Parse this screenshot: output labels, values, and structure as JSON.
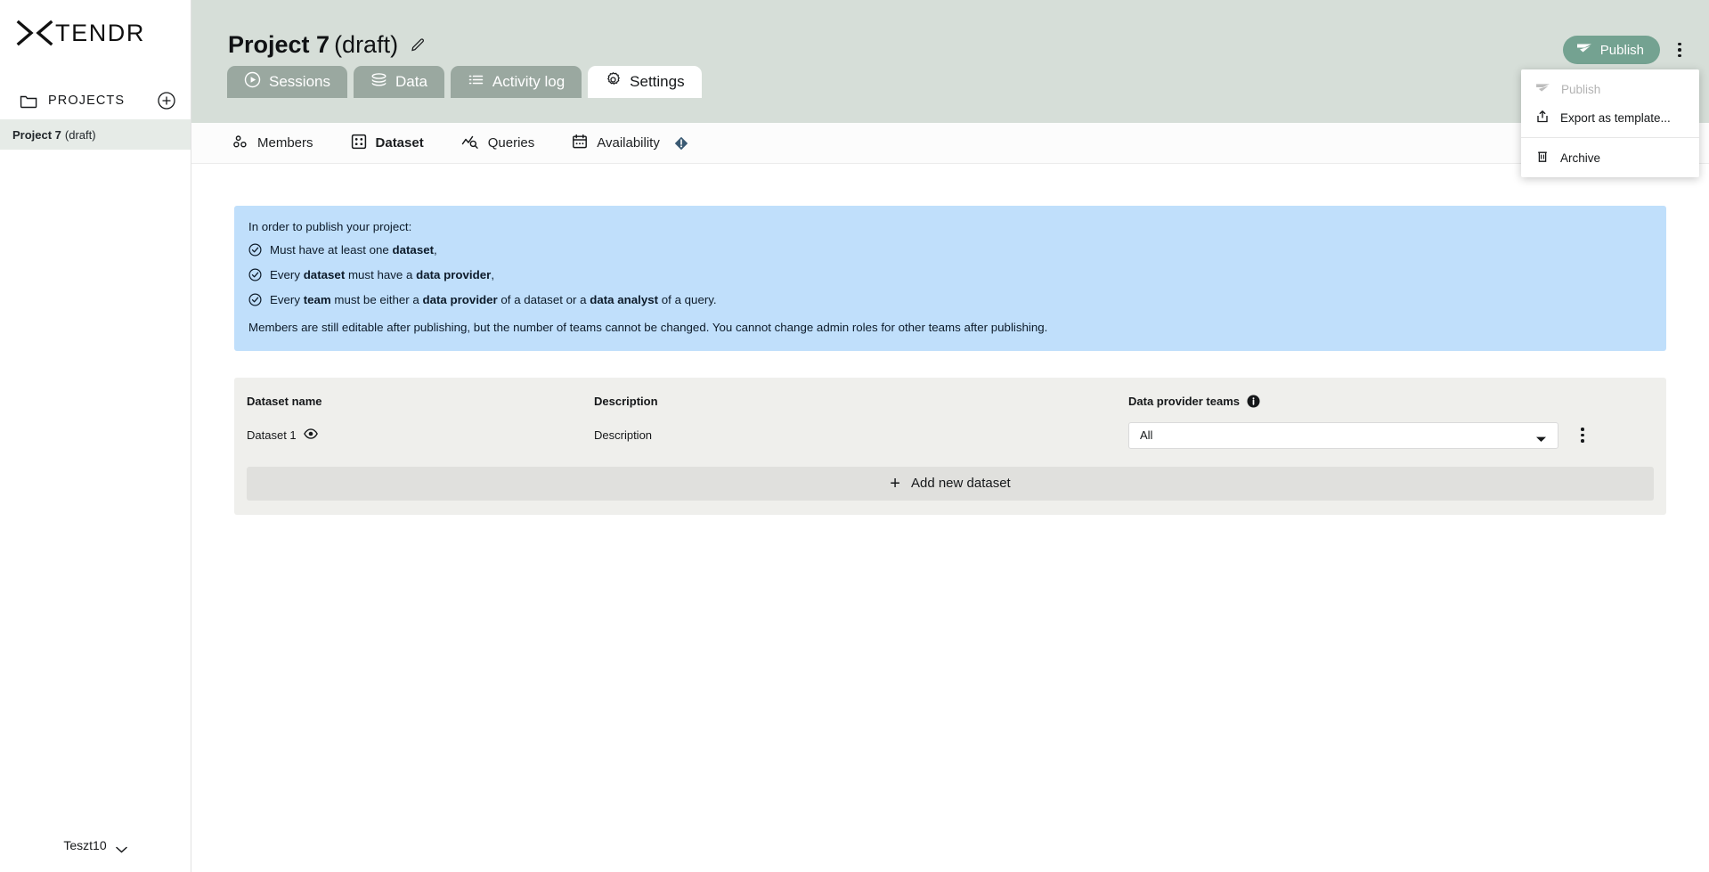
{
  "brand": {
    "name": "TENDR",
    "logo_mark": "x-arrows-icon"
  },
  "sidebar": {
    "projects_header": "PROJECTS",
    "add_project_icon": "plus-circle-icon",
    "folder_icon": "folder-icon",
    "projects": [
      {
        "name": "Project 7",
        "state": "(draft)",
        "selected": true
      }
    ],
    "user": {
      "name": "Teszt10",
      "chevron_icon": "chevron-down-icon"
    }
  },
  "header": {
    "project_name": "Project 7",
    "project_state": "(draft)",
    "edit_icon": "pencil-icon",
    "publish_button": {
      "label": "Publish",
      "icon": "send-icon",
      "color": "#74a291"
    },
    "kebab_icon": "kebab-menu-icon"
  },
  "menu": {
    "items": [
      {
        "label": "Publish",
        "icon": "send-icon",
        "disabled": true
      },
      {
        "label": "Export as template...",
        "icon": "upload-box-icon",
        "disabled": false
      },
      {
        "label": "Archive",
        "icon": "trash-icon",
        "disabled": false
      }
    ]
  },
  "tabs": [
    {
      "label": "Sessions",
      "icon": "play-circle-icon",
      "active": false
    },
    {
      "label": "Data",
      "icon": "database-icon",
      "active": false
    },
    {
      "label": "Activity log",
      "icon": "list-icon",
      "active": false
    },
    {
      "label": "Settings",
      "icon": "gear-icon",
      "active": true
    }
  ],
  "subtabs": [
    {
      "label": "Members",
      "icon": "people-icon",
      "active": false,
      "badge": null
    },
    {
      "label": "Dataset",
      "icon": "grid-icon",
      "active": true,
      "badge": null
    },
    {
      "label": "Queries",
      "icon": "chart-search-icon",
      "active": false,
      "badge": null
    },
    {
      "label": "Availability",
      "icon": "calendar-icon",
      "active": false,
      "badge": "warning-diamond-icon"
    }
  ],
  "banner": {
    "lead": "In order to publish your project:",
    "bullets": [
      {
        "icon": "check-circle-icon",
        "parts": [
          {
            "text": "Must have at least one ",
            "bold": false
          },
          {
            "text": "dataset",
            "bold": true
          },
          {
            "text": ",",
            "bold": false
          }
        ]
      },
      {
        "icon": "check-circle-icon",
        "parts": [
          {
            "text": "Every ",
            "bold": false
          },
          {
            "text": "dataset",
            "bold": true
          },
          {
            "text": " must have a ",
            "bold": false
          },
          {
            "text": "data provider",
            "bold": true
          },
          {
            "text": ",",
            "bold": false
          }
        ]
      },
      {
        "icon": "check-circle-icon",
        "parts": [
          {
            "text": "Every ",
            "bold": false
          },
          {
            "text": "team",
            "bold": true
          },
          {
            "text": " must be either a ",
            "bold": false
          },
          {
            "text": "data provider",
            "bold": true
          },
          {
            "text": " of a dataset or a ",
            "bold": false
          },
          {
            "text": "data analyst",
            "bold": true
          },
          {
            "text": " of a query.",
            "bold": false
          }
        ]
      }
    ],
    "footer": "Members are still editable after publishing, but the number of teams cannot be changed. You cannot change admin roles for other teams after publishing.",
    "color": "#c0dffb"
  },
  "dataset_table": {
    "columns": [
      {
        "key": "name",
        "label": "Dataset name"
      },
      {
        "key": "description",
        "label": "Description"
      },
      {
        "key": "teams",
        "label": "Data provider teams",
        "info_icon": "info-icon"
      }
    ],
    "rows": [
      {
        "name": "Dataset 1",
        "visibility_icon": "eye-icon",
        "description": "Description",
        "teams_value": "All",
        "teams_caret": "chevron-down-icon",
        "row_menu_icon": "kebab-menu-icon"
      }
    ],
    "add_row": {
      "label": "Add new dataset",
      "icon": "plus-icon"
    }
  }
}
